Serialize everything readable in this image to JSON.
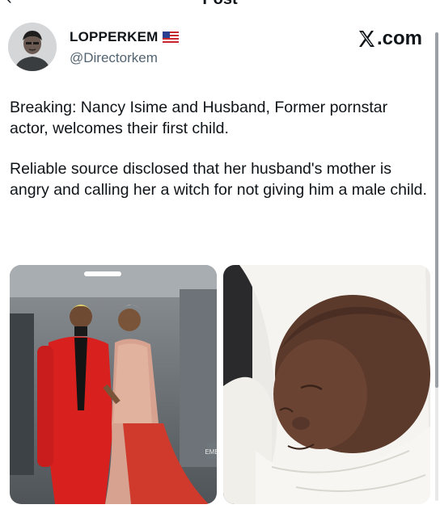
{
  "top_bar": {
    "title": "Post"
  },
  "post": {
    "author": {
      "display_name": "LOPPERKEM",
      "flag_icon": "us-flag-icon",
      "handle": "@Directorkem",
      "avatar_icon": "avatar-portrait"
    },
    "brand": "X.com",
    "paragraphs": [
      "Breaking: Nancy Isime and Husband, Former pornstar actor, welcomes their first child.",
      "Reliable source disclosed that  her husband's mother is angry and calling her a witch for not giving him a male child."
    ],
    "media": [
      {
        "icon": "couple-photo",
        "watermark": "EMB"
      },
      {
        "icon": "newborn-baby-photo"
      }
    ]
  },
  "colors": {
    "text": "#0f1419",
    "secondary_text": "#536471",
    "red_suit": "#d8211f",
    "background": "#ffffff"
  }
}
